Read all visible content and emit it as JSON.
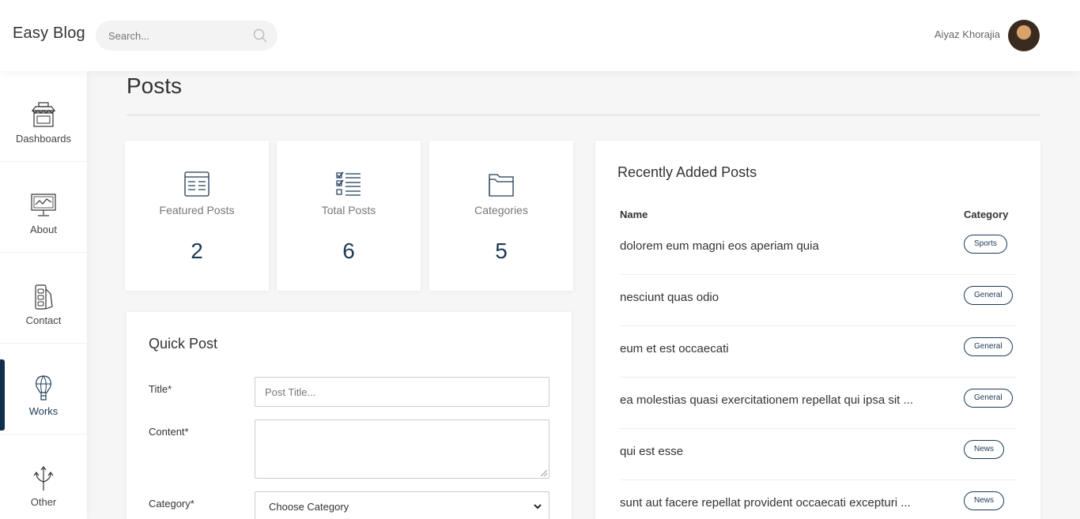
{
  "header": {
    "brand": "Easy Blog",
    "search_placeholder": "Search...",
    "user_name": "Aiyaz Khorajia"
  },
  "sidebar": {
    "items": [
      {
        "label": "Dashboards",
        "icon": "store-icon"
      },
      {
        "label": "About",
        "icon": "monitor-chart-icon"
      },
      {
        "label": "Contact",
        "icon": "phone-book-icon"
      },
      {
        "label": "Works",
        "icon": "balloon-icon",
        "active": true
      },
      {
        "label": "Other",
        "icon": "arrows-split-icon"
      }
    ]
  },
  "page": {
    "title": "Posts"
  },
  "stats": [
    {
      "label": "Featured Posts",
      "value": "2",
      "icon": "document-icon"
    },
    {
      "label": "Total Posts",
      "value": "6",
      "icon": "checklist-icon"
    },
    {
      "label": "Categories",
      "value": "5",
      "icon": "folder-icon"
    }
  ],
  "quick_post": {
    "title": "Quick Post",
    "title_label": "Title*",
    "title_placeholder": "Post Title...",
    "content_label": "Content*",
    "category_label": "Category*",
    "category_value": "Choose Category"
  },
  "recent": {
    "title": "Recently Added Posts",
    "col_name": "Name",
    "col_category": "Category",
    "rows": [
      {
        "name": "dolorem eum magni eos aperiam quia",
        "category": "Sports"
      },
      {
        "name": "nesciunt quas odio",
        "category": "General"
      },
      {
        "name": "eum et est occaecati",
        "category": "General"
      },
      {
        "name": "ea molestias quasi exercitationem repellat qui ipsa sit ...",
        "category": "General"
      },
      {
        "name": "qui est esse",
        "category": "News"
      },
      {
        "name": "sunt aut facere repellat provident occaecati excepturi ...",
        "category": "News"
      }
    ]
  },
  "colors": {
    "accent": "#0f2f4a",
    "badge": "#1d3a55"
  }
}
